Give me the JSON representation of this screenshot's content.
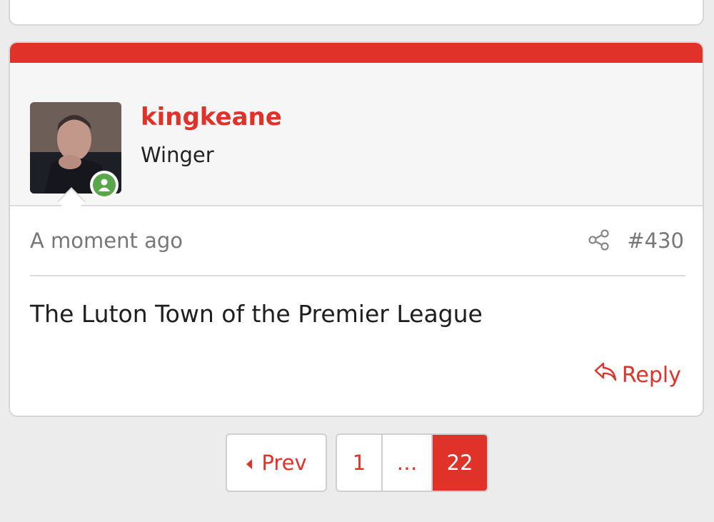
{
  "post": {
    "username": "kingkeane",
    "user_title": "Winger",
    "time": "A moment ago",
    "number": "#430",
    "body": "The Luton Town of the Premier League",
    "reply_label": "Reply",
    "accent_color": "#e1322a",
    "online_status": "online"
  },
  "pagination": {
    "prev_label": "Prev",
    "pages": [
      "1",
      "…",
      "22"
    ],
    "current": "22"
  },
  "icons": {
    "share": "share-icon",
    "reply": "reply-arrow-icon",
    "prev": "caret-left-icon",
    "online": "user-online-icon"
  }
}
